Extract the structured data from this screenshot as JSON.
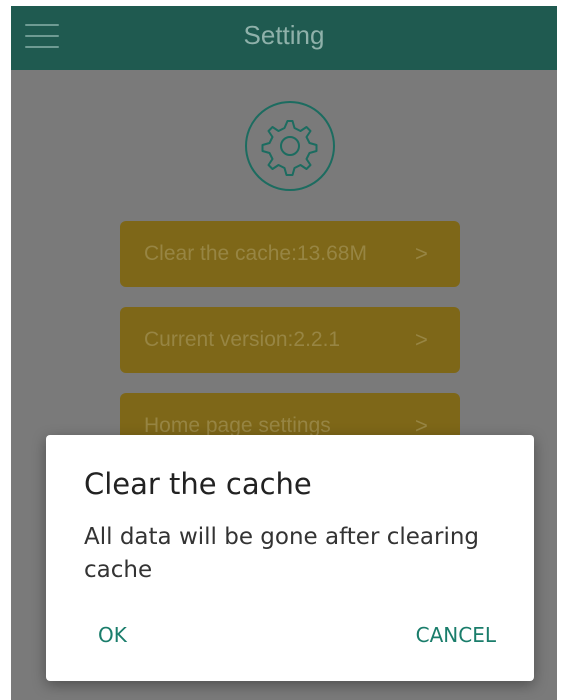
{
  "header": {
    "title": "Setting",
    "menu_icon": "hamburger-menu-icon"
  },
  "main": {
    "settings_icon": "gear-icon",
    "items": [
      {
        "label": "Clear the cache:13.68M",
        "chevron": ">"
      },
      {
        "label": "Current version:2.2.1",
        "chevron": ">"
      },
      {
        "label": "Home page settings",
        "chevron": ">"
      }
    ]
  },
  "dialog": {
    "title": "Clear the cache",
    "message": "All data will be gone after clearing cache",
    "ok_label": "OK",
    "cancel_label": "CANCEL"
  },
  "colors": {
    "appbar": "#1f5a50",
    "accent": "#1a7d6b",
    "item_background": "#7e6718",
    "scrim": "#7a7a7a"
  }
}
